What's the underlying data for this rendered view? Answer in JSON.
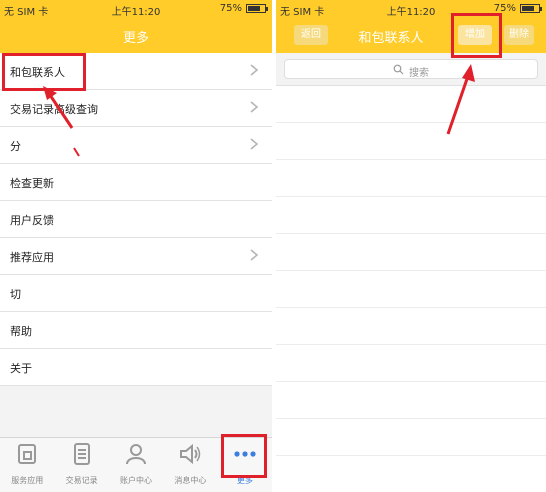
{
  "left": {
    "status": {
      "carrier": "无 SIM 卡 ",
      "time": "上午11:20",
      "battery": "75%",
      "battery_level": 0.75
    },
    "nav": {
      "title": "更多"
    },
    "menu": [
      {
        "label": "和包联系人",
        "chevron": true
      },
      {
        "label": "交易记录高级查询",
        "chevron": true
      },
      {
        "label": "分",
        "chevron": true
      },
      {
        "label": "检查更新",
        "chevron": false
      },
      {
        "label": "用户反馈",
        "chevron": false
      },
      {
        "label": "推荐应用",
        "chevron": true
      },
      {
        "label": "切",
        "chevron": false
      },
      {
        "label": "帮助",
        "chevron": false
      },
      {
        "label": "关于",
        "chevron": false
      }
    ],
    "tabs": [
      {
        "label": "服务应用",
        "icon": "service-icon"
      },
      {
        "label": "交易记录",
        "icon": "record-icon"
      },
      {
        "label": "账户中心",
        "icon": "account-icon"
      },
      {
        "label": "消息中心",
        "icon": "speaker-icon"
      },
      {
        "label": "更多",
        "icon": "more-icon"
      }
    ]
  },
  "right": {
    "status": {
      "carrier": "无 SIM 卡 ",
      "time": "上午11:20",
      "battery": "75%",
      "battery_level": 0.75
    },
    "nav": {
      "title": "和包联系人",
      "back": "返回",
      "add": "增加",
      "delete": "删除"
    },
    "search": {
      "placeholder": "搜索"
    }
  },
  "colors": {
    "accent": "#ffcc2a",
    "highlight": "#e0202a",
    "active_tab": "#3a7fe0"
  }
}
